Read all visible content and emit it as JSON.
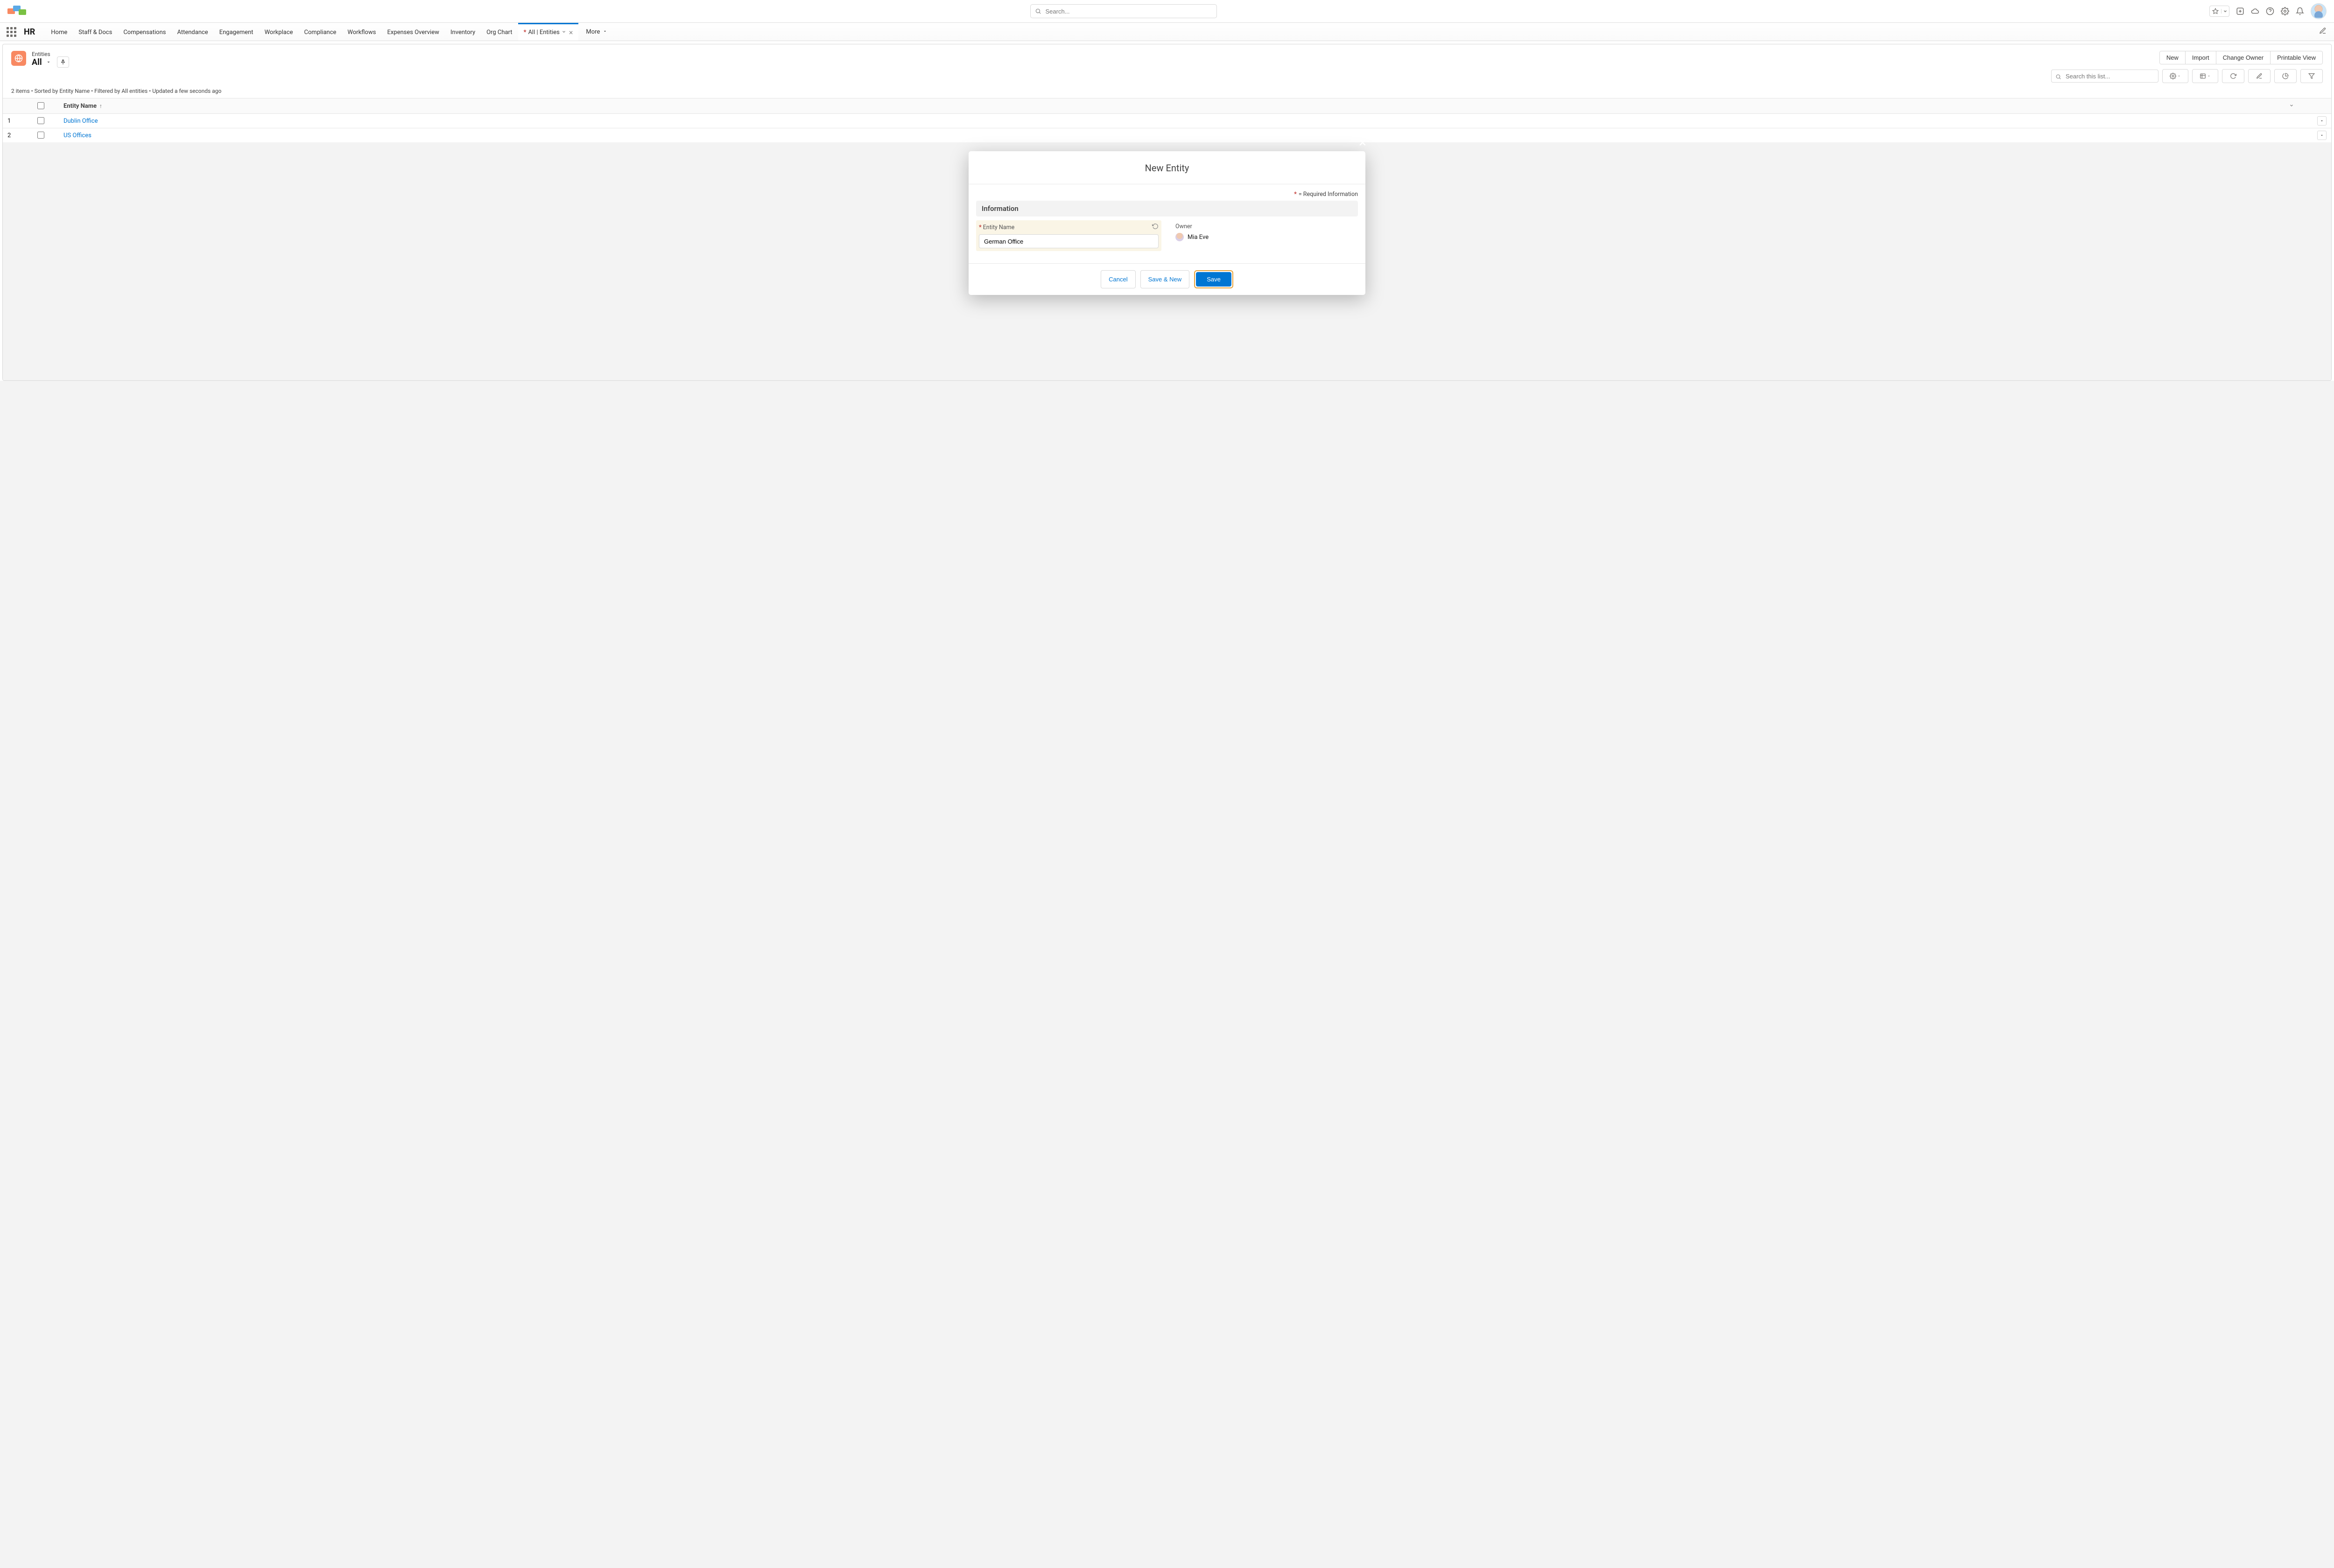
{
  "topbar": {
    "search_placeholder": "Search..."
  },
  "nav": {
    "app_name": "HR",
    "tabs": [
      {
        "label": "Home"
      },
      {
        "label": "Staff & Docs"
      },
      {
        "label": "Compensations"
      },
      {
        "label": "Attendance"
      },
      {
        "label": "Engagement"
      },
      {
        "label": "Workplace"
      },
      {
        "label": "Compliance"
      },
      {
        "label": "Workflows"
      },
      {
        "label": "Expenses Overview"
      },
      {
        "label": "Inventory"
      },
      {
        "label": "Org Chart"
      }
    ],
    "active_tab_prefix": "*",
    "active_tab_label": "All | Entities",
    "more": "More"
  },
  "list": {
    "object_label": "Entities",
    "view_name": "All",
    "meta": "2 items • Sorted by Entity Name • Filtered by All entities • Updated a few seconds ago",
    "actions": {
      "new": "New",
      "import": "Import",
      "change_owner": "Change Owner",
      "printable_view": "Printable View"
    },
    "search_placeholder": "Search this list...",
    "column_header": "Entity Name",
    "rows": [
      {
        "num": "1",
        "name": "Dublin Office"
      },
      {
        "num": "2",
        "name": "US Offices"
      }
    ]
  },
  "modal": {
    "title": "New Entity",
    "required_note": "= Required Information",
    "section": "Information",
    "field_label": "Entity Name",
    "field_value": "German Office",
    "owner_label": "Owner",
    "owner_name": "Mia Eve",
    "cancel": "Cancel",
    "save_new": "Save & New",
    "save": "Save"
  }
}
